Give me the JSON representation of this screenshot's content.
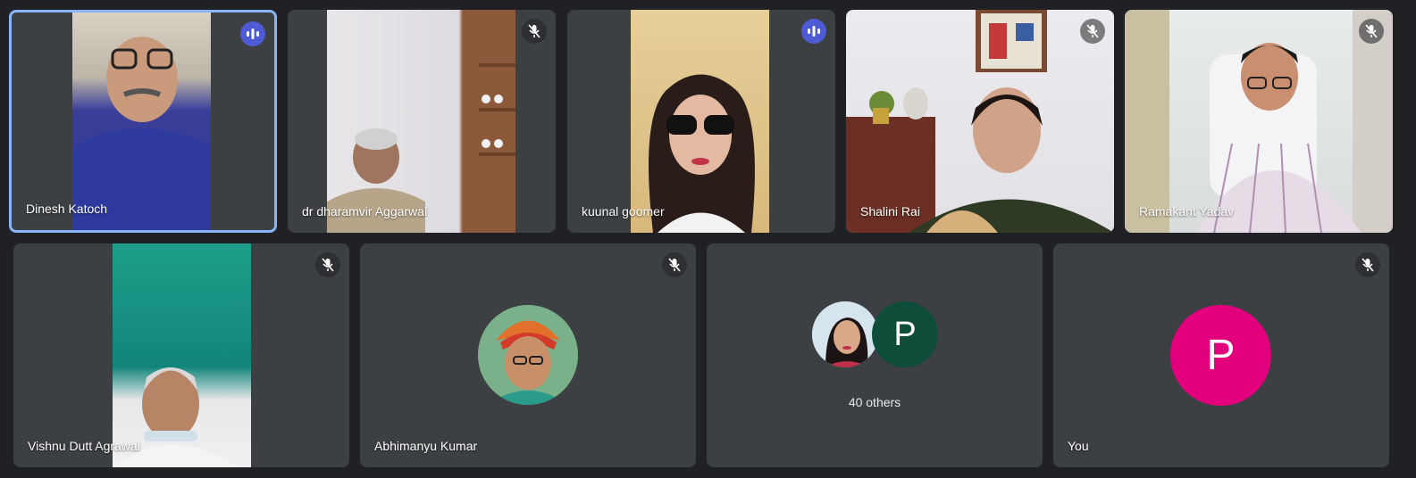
{
  "participants": [
    {
      "name": "Dinesh Katoch",
      "mic": "speaking"
    },
    {
      "name": "dr dharamvir Aggarwal",
      "mic": "muted"
    },
    {
      "name": "kuunal goomer",
      "mic": "speaking"
    },
    {
      "name": "Shalini Rai",
      "mic": "muted"
    },
    {
      "name": "Ramakant Yadav",
      "mic": "muted"
    },
    {
      "name": "Vishnu Dutt Agrawal",
      "mic": "muted"
    },
    {
      "name": "Abhimanyu Kumar",
      "mic": "muted"
    }
  ],
  "others": {
    "label": "40 others",
    "avatar_letter": "P"
  },
  "self": {
    "name": "You",
    "avatar_letter": "P",
    "avatar_color": "#e3007d",
    "mic": "muted"
  },
  "colors": {
    "background": "#202124",
    "tile": "#3c4043",
    "active_border": "#8ab4f8",
    "speaking": "#4f5bd5"
  }
}
